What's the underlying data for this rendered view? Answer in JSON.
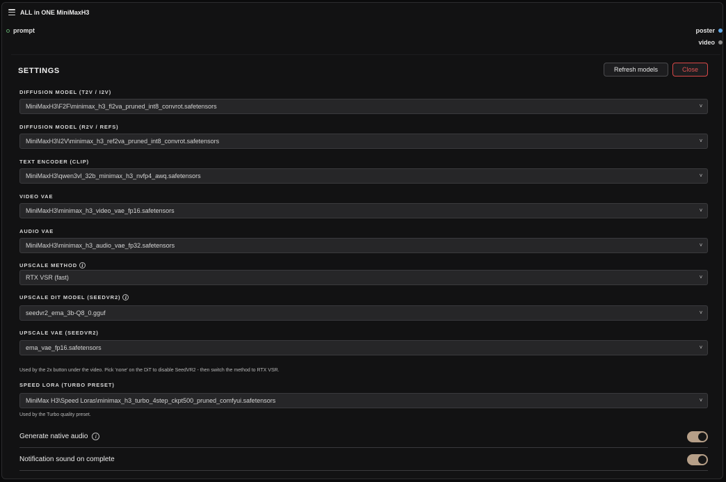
{
  "node": {
    "title": "ALL in ONE MiniMaxH3",
    "input_slot": "prompt",
    "outputs": [
      {
        "label": "poster",
        "color": "#5fa8e8"
      },
      {
        "label": "video",
        "color": "#8a8a8a"
      }
    ]
  },
  "settings": {
    "title": "SETTINGS",
    "refresh_label": "Refresh models",
    "close_label": "Close",
    "fields": [
      {
        "label": "DIFFUSION MODEL (T2V / I2V)",
        "value": "MiniMaxH3\\F2F\\minimax_h3_fl2va_pruned_int8_convrot.safetensors"
      },
      {
        "label": "DIFFUSION MODEL (R2V / REFS)",
        "value": "MiniMaxH3\\I2V\\minimax_h3_ref2va_pruned_int8_convrot.safetensors"
      },
      {
        "label": "TEXT ENCODER (CLIP)",
        "value": "MiniMaxH3\\qwen3vl_32b_minimax_h3_nvfp4_awq.safetensors"
      },
      {
        "label": "VIDEO VAE",
        "value": "MiniMaxH3\\minimax_h3_video_vae_fp16.safetensors"
      },
      {
        "label": "AUDIO VAE",
        "value": "MiniMaxH3\\minimax_h3_audio_vae_fp32.safetensors"
      },
      {
        "label": "UPSCALE METHOD",
        "value": "RTX VSR (fast)"
      },
      {
        "label": "UPSCALE DIT MODEL (SEEDVR2)",
        "value": "seedvr2_ema_3b-Q8_0.gguf"
      },
      {
        "label": "UPSCALE VAE (SEEDVR2)",
        "value": "ema_vae_fp16.safetensors"
      },
      {
        "label": "SPEED LORA (TURBO PRESET)",
        "value": "MiniMax H3\\Speed Loras\\minimax_h3_turbo_4step_ckpt500_pruned_comfyui.safetensors"
      }
    ],
    "upscale_hint": "Used by the 2x button under the video. Pick 'none' on the DiT to disable SeedVR2 - then switch the method to RTX VSR.",
    "lora_hint": "Used by the Turbo quality preset.",
    "toggles": [
      {
        "label": "Generate native audio",
        "on": true
      },
      {
        "label": "Notification sound on complete",
        "on": true
      }
    ],
    "accent_toggle": "#b69f88",
    "close_color": "#d94848"
  }
}
